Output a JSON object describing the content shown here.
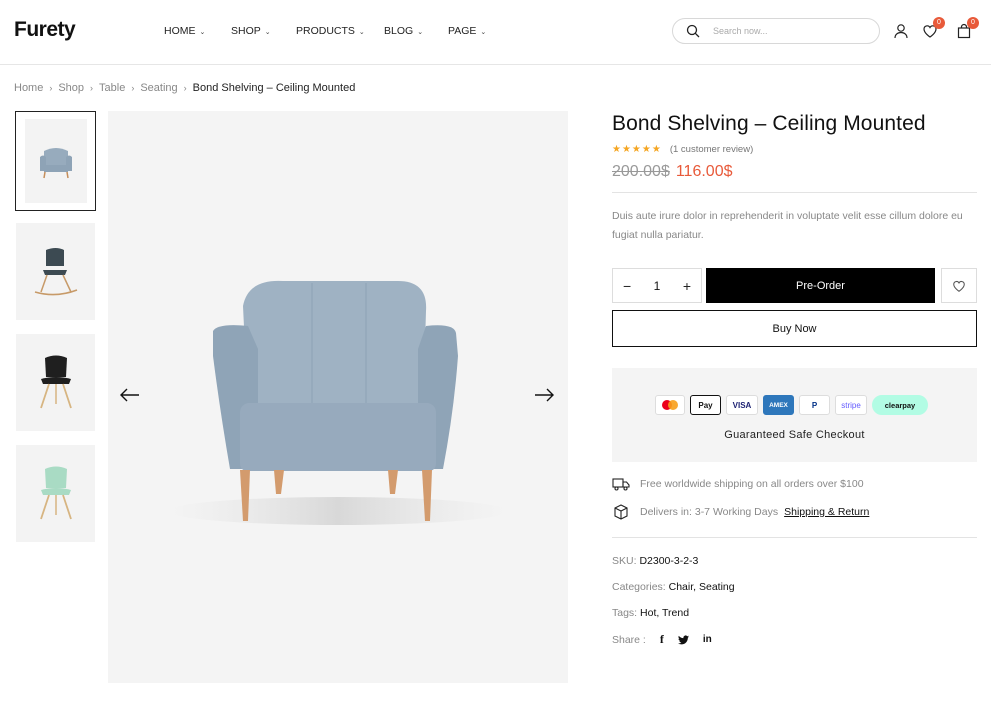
{
  "brand": {
    "logo": "Furety"
  },
  "nav": [
    {
      "label": "HOME"
    },
    {
      "label": "SHOP"
    },
    {
      "label": "PRODUCTS"
    },
    {
      "label": "BLOG"
    },
    {
      "label": "PAGE"
    }
  ],
  "search": {
    "placeholder": "Search now...",
    "value": ""
  },
  "header_icons": {
    "wishlist_count": "0",
    "cart_count": "0"
  },
  "breadcrumb": [
    "Home",
    "Shop",
    "Table",
    "Seating",
    "Bond Shelving – Ceiling Mounted"
  ],
  "product": {
    "title": "Bond Shelving – Ceiling Mounted",
    "stars": "★★★★★",
    "rating": 5,
    "review_text": "(1 customer review)",
    "old_price": "200.00$",
    "new_price": "116.00$",
    "description": "Duis aute irure dolor in reprehenderit in voluptate velit esse cillum dolore eu fugiat nulla pariatur.",
    "quantity": "1",
    "preorder_label": "Pre-Order",
    "buynow_label": "Buy Now",
    "checkout_label": "Guaranteed Safe Checkout",
    "payments": [
      "Pay",
      "VISA",
      "AMEX",
      "P",
      "stripe",
      "clearpay"
    ],
    "shipping_text": "Free worldwide shipping on all orders over $100",
    "delivery_text": "Delivers in: 3-7 Working Days",
    "shipping_link": "Shipping & Return",
    "sku_label": "SKU:",
    "sku": "D2300-3-2-3",
    "categories_label": "Categories:",
    "categories": [
      "Chair",
      "Seating"
    ],
    "tags_label": "Tags:",
    "tags": [
      "Hot",
      "Trend"
    ],
    "share_label": "Share :",
    "share_icons": [
      "f",
      "t",
      "in"
    ]
  },
  "colors": {
    "accent": "#e85a3a",
    "star": "#f5a623",
    "primary_button": "#000000"
  }
}
